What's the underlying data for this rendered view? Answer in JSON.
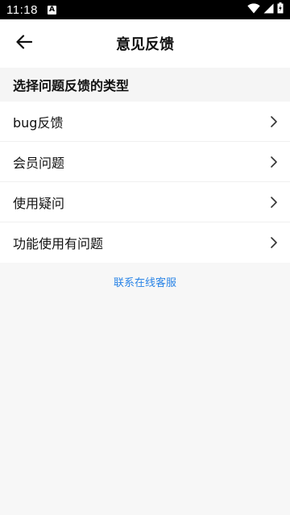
{
  "status_bar": {
    "time": "11:18",
    "notification_icon": "A",
    "icons": [
      "wifi-icon",
      "signal-icon",
      "battery-icon"
    ]
  },
  "header": {
    "title": "意见反馈",
    "back_icon": "arrow-left-icon"
  },
  "section": {
    "title": "选择问题反馈的类型"
  },
  "items": [
    {
      "label": "bug反馈",
      "icon": "chevron-right-icon"
    },
    {
      "label": "会员问题",
      "icon": "chevron-right-icon"
    },
    {
      "label": "使用疑问",
      "icon": "chevron-right-icon"
    },
    {
      "label": "功能使用有问题",
      "icon": "chevron-right-icon"
    }
  ],
  "contact": {
    "label": "联系在线客服"
  },
  "colors": {
    "accent": "#2a84e6",
    "background": "#f7f7f7",
    "status_bar": "#000000"
  }
}
